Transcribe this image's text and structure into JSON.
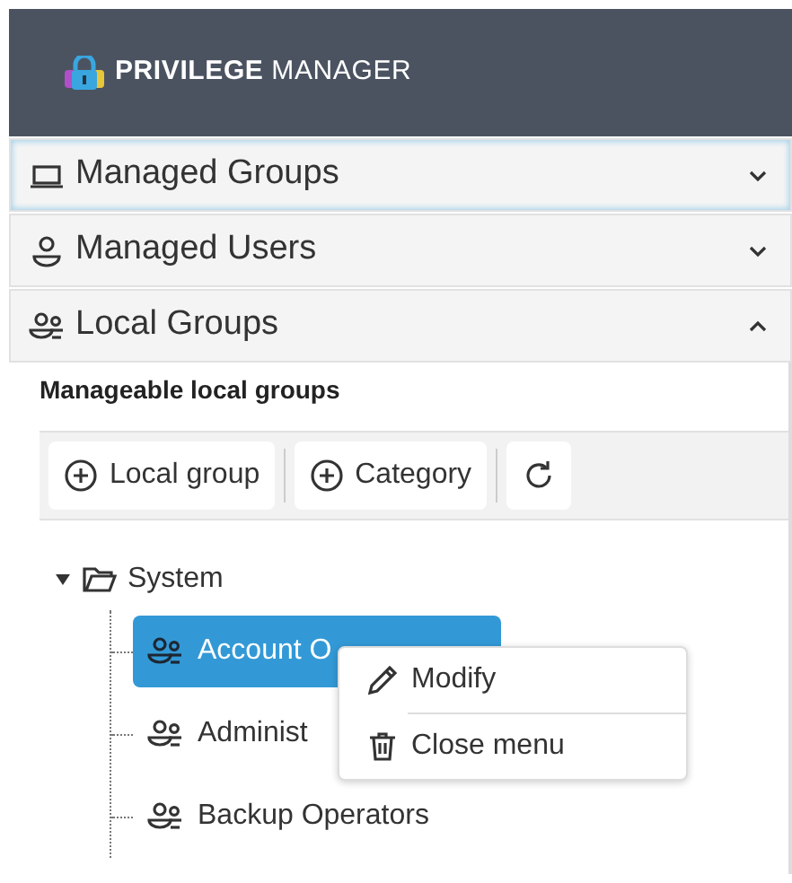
{
  "header": {
    "brand_bold": "PRIVILEGE",
    "brand_light": "MANAGER"
  },
  "sections": [
    {
      "label": "Managed Groups",
      "expanded": false,
      "selected": true
    },
    {
      "label": "Managed Users",
      "expanded": false,
      "selected": false
    },
    {
      "label": "Local Groups",
      "expanded": true,
      "selected": false
    }
  ],
  "panel": {
    "title": "Manageable local groups",
    "toolbar": [
      {
        "kind": "add",
        "label": "Local group"
      },
      {
        "kind": "add",
        "label": "Category"
      },
      {
        "kind": "refresh"
      }
    ],
    "tree": [
      {
        "label": "System",
        "expanded": true,
        "children": [
          {
            "label": "Account O",
            "selected": true
          },
          {
            "label": "Administ",
            "selected": false
          },
          {
            "label": "Backup Operators",
            "selected": false
          }
        ]
      }
    ]
  },
  "context_menu": [
    {
      "label": "Modify"
    },
    {
      "label": "Close menu"
    }
  ]
}
